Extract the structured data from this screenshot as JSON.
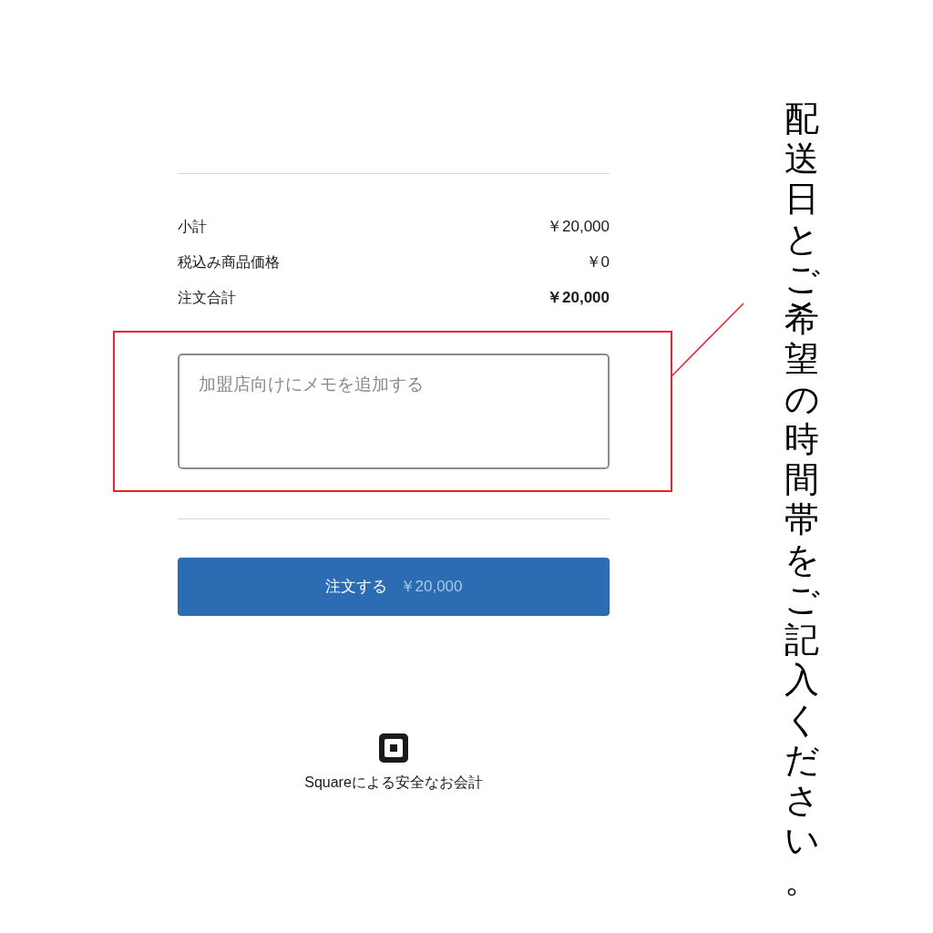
{
  "summary": {
    "rows": [
      {
        "label": "小計",
        "value": "￥20,000",
        "bold": false
      },
      {
        "label": "税込み商品価格",
        "value": "￥0",
        "bold": false
      },
      {
        "label": "注文合計",
        "value": "￥20,000",
        "bold": true
      }
    ]
  },
  "memo": {
    "placeholder": "加盟店向けにメモを追加する"
  },
  "order_button": {
    "label": "注文する",
    "amount": "￥20,000"
  },
  "footer": {
    "text": "Squareによる安全なお会計"
  },
  "annotation": {
    "text": "配送日とご希望の時間帯をご記入ください。"
  }
}
